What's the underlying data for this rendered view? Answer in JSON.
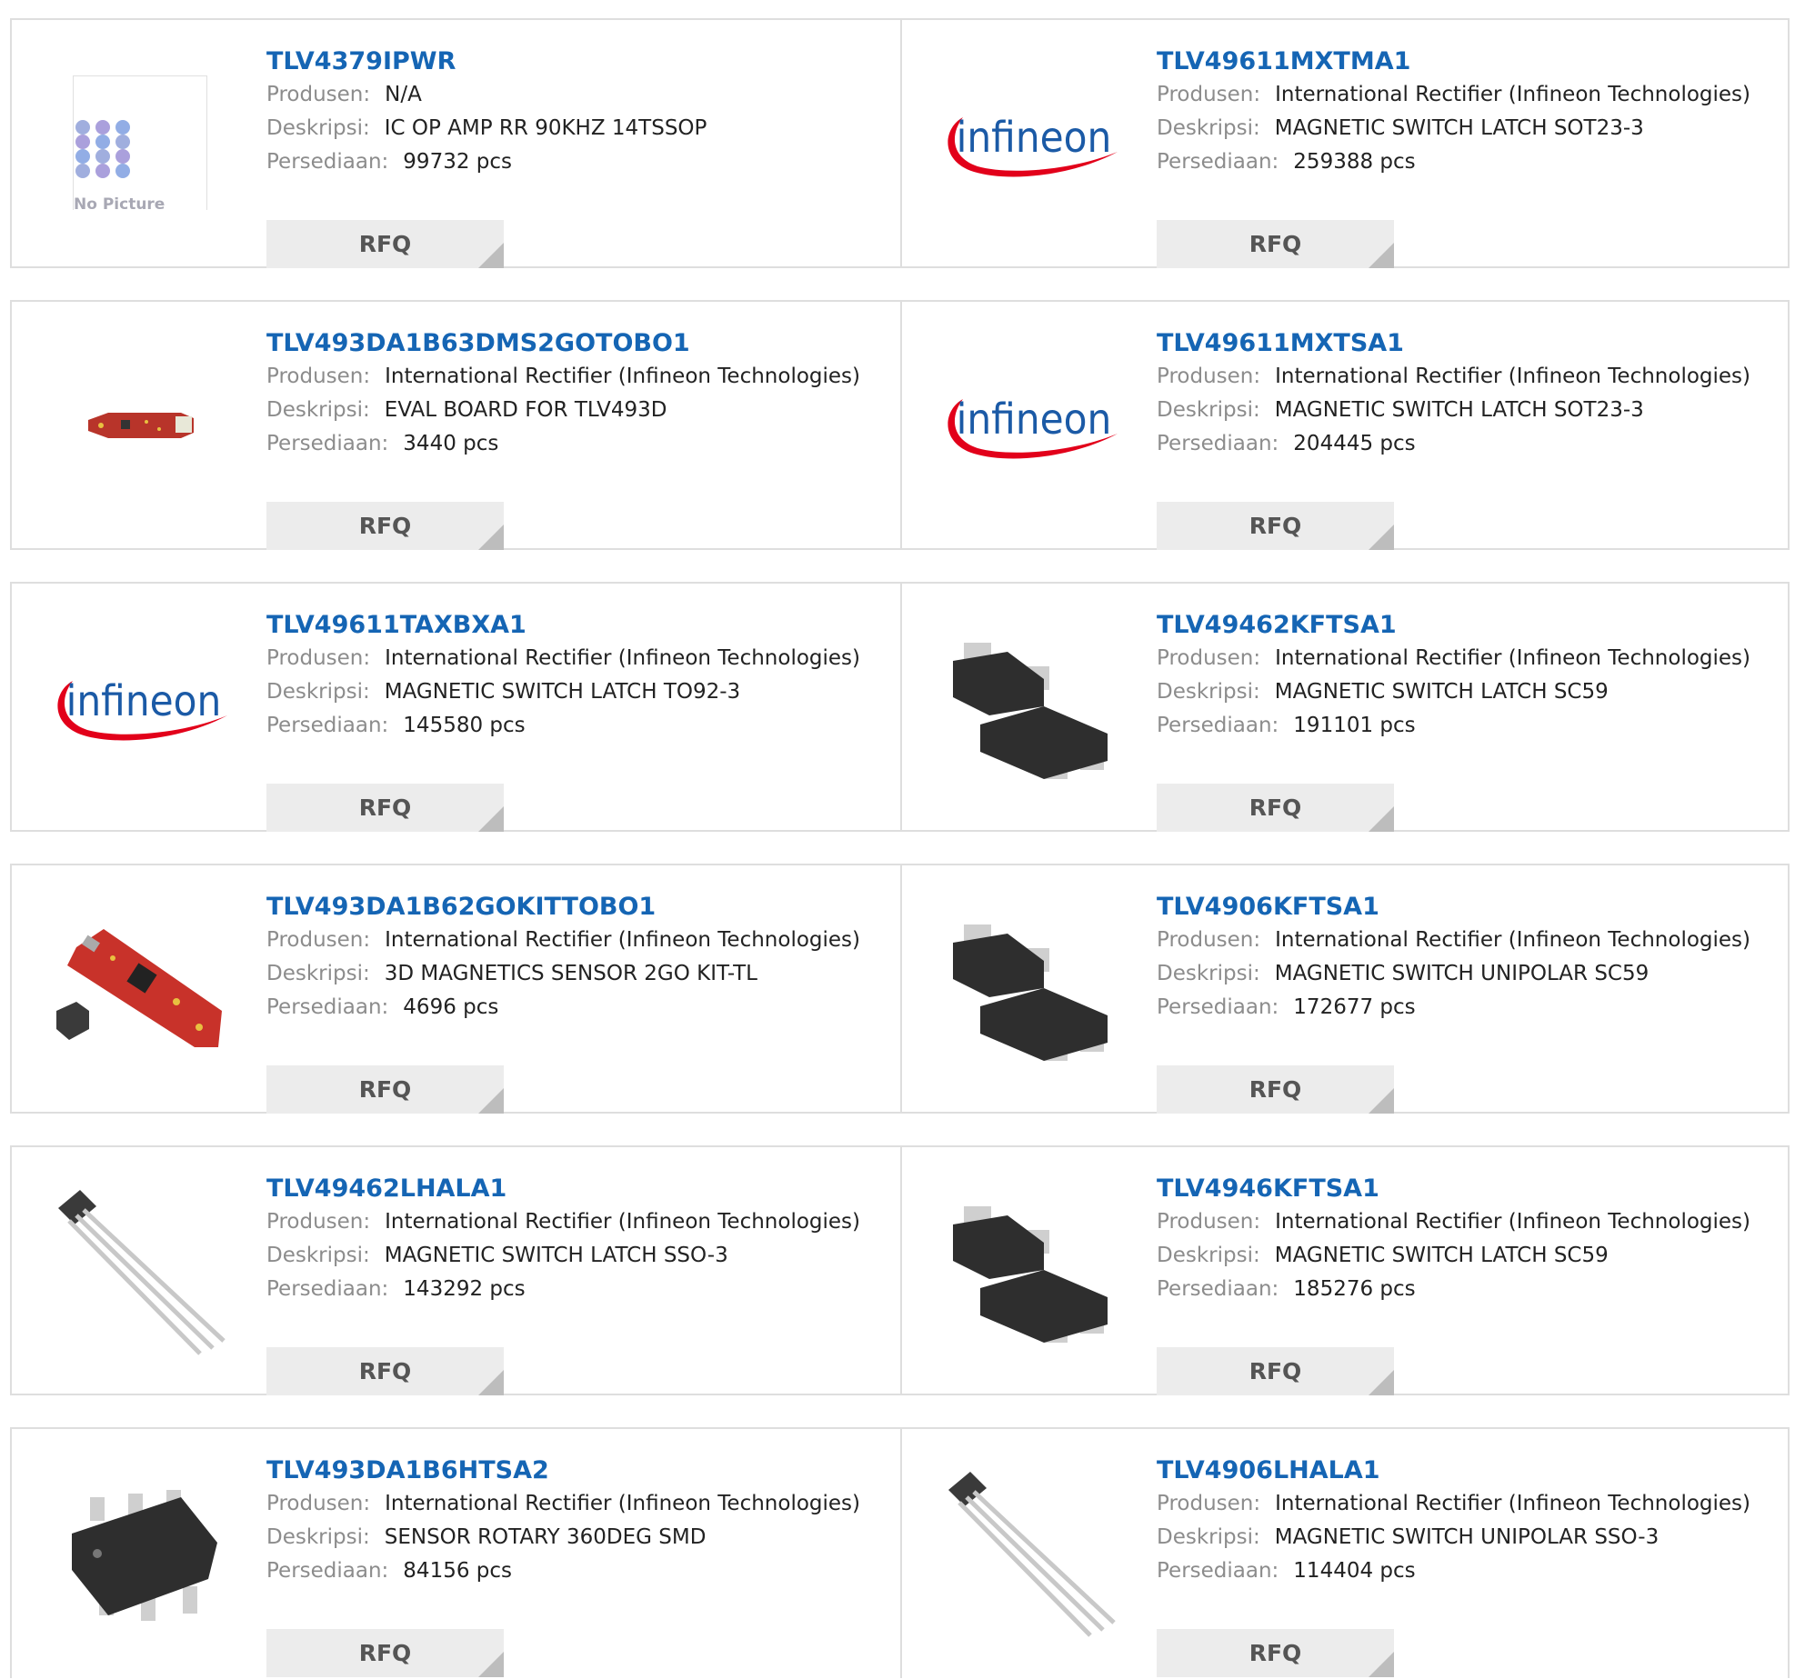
{
  "labels": {
    "manufacturer": "Produsen:",
    "description": "Deskripsi:",
    "stock": "Persediaan:",
    "rfq": "RFQ",
    "no_picture": "No Picture"
  },
  "colors": {
    "part_link": "#1565b4",
    "border": "#dedede",
    "rfq_bg": "#ececec"
  },
  "products": [
    {
      "part": "TLV4379IPWR",
      "manufacturer": "N/A",
      "description": "IC OP AMP RR 90KHZ 14TSSOP",
      "stock": "99732 pcs",
      "image": "no-picture-icon"
    },
    {
      "part": "TLV49611MXTMA1",
      "manufacturer": "International Rectifier (Infineon Technologies)",
      "description": "MAGNETIC SWITCH LATCH SOT23-3",
      "stock": "259388 pcs",
      "image": "infineon-logo"
    },
    {
      "part": "TLV493DA1B63DMS2GOTOBO1",
      "manufacturer": "International Rectifier (Infineon Technologies)",
      "description": "EVAL BOARD FOR TLV493D",
      "stock": "3440 pcs",
      "image": "eval-board-small-image"
    },
    {
      "part": "TLV49611MXTSA1",
      "manufacturer": "International Rectifier (Infineon Technologies)",
      "description": "MAGNETIC SWITCH LATCH SOT23-3",
      "stock": "204445 pcs",
      "image": "infineon-logo"
    },
    {
      "part": "TLV49611TAXBXA1",
      "manufacturer": "International Rectifier (Infineon Technologies)",
      "description": "MAGNETIC SWITCH LATCH TO92-3",
      "stock": "145580 pcs",
      "image": "infineon-logo"
    },
    {
      "part": "TLV49462KFTSA1",
      "manufacturer": "International Rectifier (Infineon Technologies)",
      "description": "MAGNETIC SWITCH LATCH SC59",
      "stock": "191101 pcs",
      "image": "sot-package-image"
    },
    {
      "part": "TLV493DA1B62GOKITTOBO1",
      "manufacturer": "International Rectifier (Infineon Technologies)",
      "description": "3D MAGNETICS SENSOR 2GO KIT-TL",
      "stock": "4696 pcs",
      "image": "kit-board-image"
    },
    {
      "part": "TLV4906KFTSA1",
      "manufacturer": "International Rectifier (Infineon Technologies)",
      "description": "MAGNETIC SWITCH UNIPOLAR SC59",
      "stock": "172677 pcs",
      "image": "sot-package-image"
    },
    {
      "part": "TLV49462LHALA1",
      "manufacturer": "International Rectifier (Infineon Technologies)",
      "description": "MAGNETIC SWITCH LATCH SSO-3",
      "stock": "143292 pcs",
      "image": "sso3-package-image"
    },
    {
      "part": "TLV4946KFTSA1",
      "manufacturer": "International Rectifier (Infineon Technologies)",
      "description": "MAGNETIC SWITCH LATCH SC59",
      "stock": "185276 pcs",
      "image": "sot-package-image"
    },
    {
      "part": "TLV493DA1B6HTSA2",
      "manufacturer": "International Rectifier (Infineon Technologies)",
      "description": "SENSOR ROTARY 360DEG SMD",
      "stock": "84156 pcs",
      "image": "tsop6-chip-image"
    },
    {
      "part": "TLV4906LHALA1",
      "manufacturer": "International Rectifier (Infineon Technologies)",
      "description": "MAGNETIC SWITCH UNIPOLAR SSO-3",
      "stock": "114404 pcs",
      "image": "sso3-package-image"
    }
  ]
}
